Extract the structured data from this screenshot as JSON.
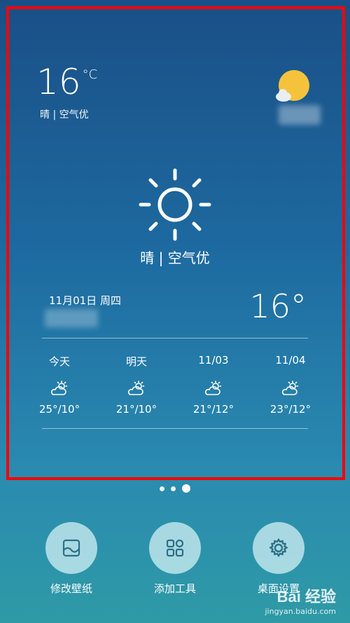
{
  "widget": {
    "top_temp": "16",
    "top_unit": "°C",
    "top_desc": "晴 | 空气优",
    "center_desc": "晴 | 空气优",
    "date": "11月01日 周四",
    "current_temp": "16°"
  },
  "forecast": [
    {
      "label": "今天",
      "temp": "25°/10°"
    },
    {
      "label": "明天",
      "temp": "21°/10°"
    },
    {
      "label": "11/03",
      "temp": "21°/12°"
    },
    {
      "label": "11/04",
      "temp": "23°/12°"
    }
  ],
  "dock": [
    {
      "label": "修改壁纸",
      "icon": "wallpaper-icon"
    },
    {
      "label": "添加工具",
      "icon": "widgets-icon"
    },
    {
      "label": "桌面设置",
      "icon": "gear-icon"
    }
  ],
  "watermark": {
    "main": "Bai 经验",
    "sub": "jingyan.baidu.com"
  },
  "colors": {
    "highlight": "#ff0000",
    "sun": "#f5c33b"
  }
}
